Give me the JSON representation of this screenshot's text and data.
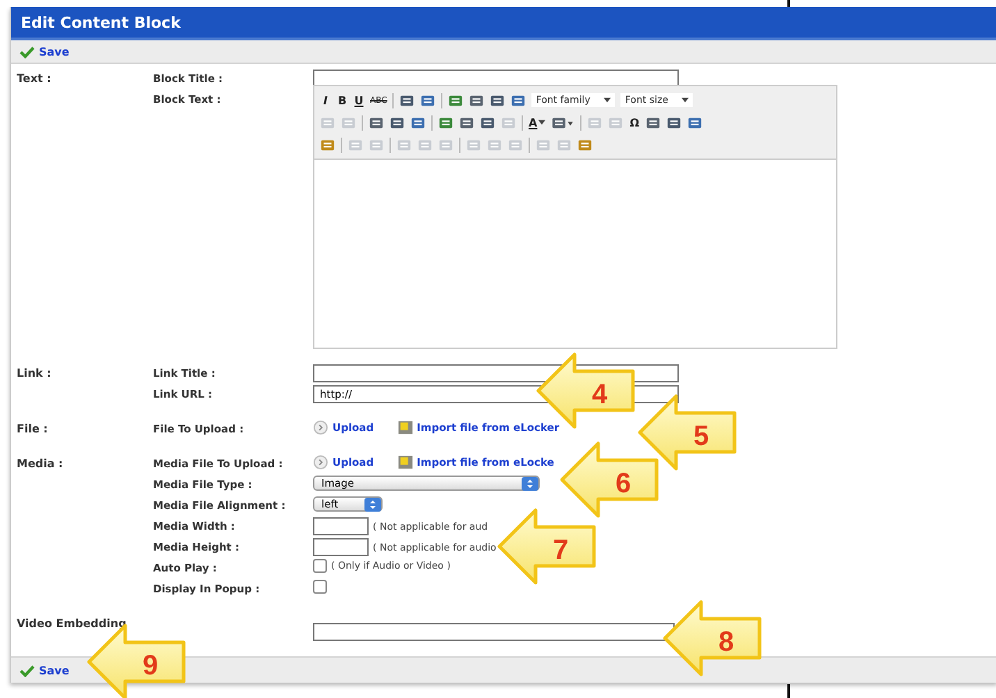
{
  "window": {
    "title": "Edit Content Block"
  },
  "top_toolbar": {
    "save": "Save"
  },
  "sections": [
    {
      "label": "Text :",
      "rows": [
        {
          "kind": "text",
          "label": "Block Title :",
          "value": ""
        },
        {
          "kind": "editor",
          "label": "Block Text :",
          "toolbar": [
            [
              {
                "kind": "italic",
                "text": "I"
              },
              {
                "kind": "bold",
                "text": "B"
              },
              {
                "kind": "underline",
                "text": "U"
              },
              {
                "kind": "strike",
                "text": "ABC"
              },
              {
                "kind": "sep"
              },
              {
                "kind": "icon",
                "disabled": false
              },
              {
                "kind": "icon",
                "disabled": false
              },
              {
                "kind": "sep"
              },
              {
                "kind": "icon",
                "disabled": false
              },
              {
                "kind": "icon",
                "disabled": false
              },
              {
                "kind": "icon",
                "disabled": false
              },
              {
                "kind": "icon",
                "disabled": false
              },
              {
                "kind": "select",
                "text": "Font family"
              },
              {
                "kind": "select",
                "text": "Font size"
              }
            ],
            [
              {
                "kind": "icon",
                "disabled": true
              },
              {
                "kind": "icon",
                "disabled": true
              },
              {
                "kind": "sep"
              },
              {
                "kind": "icon",
                "disabled": false
              },
              {
                "kind": "icon",
                "disabled": false
              },
              {
                "kind": "icon",
                "disabled": false
              },
              {
                "kind": "sep"
              },
              {
                "kind": "icon",
                "disabled": false
              },
              {
                "kind": "icon",
                "disabled": false
              },
              {
                "kind": "icon",
                "disabled": false
              },
              {
                "kind": "icon",
                "disabled": true
              },
              {
                "kind": "sep"
              },
              {
                "kind": "underline",
                "text": "A",
                "caret": true
              },
              {
                "kind": "icon",
                "disabled": false,
                "caret": true
              },
              {
                "kind": "sep"
              },
              {
                "kind": "icon",
                "disabled": true
              },
              {
                "kind": "icon",
                "disabled": true
              },
              {
                "kind": "bold",
                "text": "Ω"
              },
              {
                "kind": "icon",
                "disabled": false
              },
              {
                "kind": "icon",
                "disabled": false
              },
              {
                "kind": "icon",
                "disabled": false
              }
            ],
            [
              {
                "kind": "icon",
                "disabled": false
              },
              {
                "kind": "sep"
              },
              {
                "kind": "icon",
                "disabled": true
              },
              {
                "kind": "icon",
                "disabled": true
              },
              {
                "kind": "sep"
              },
              {
                "kind": "icon",
                "disabled": true
              },
              {
                "kind": "icon",
                "disabled": true
              },
              {
                "kind": "icon",
                "disabled": true
              },
              {
                "kind": "sep"
              },
              {
                "kind": "icon",
                "disabled": true
              },
              {
                "kind": "icon",
                "disabled": true
              },
              {
                "kind": "icon",
                "disabled": true
              },
              {
                "kind": "sep"
              },
              {
                "kind": "icon",
                "disabled": true
              },
              {
                "kind": "icon",
                "disabled": true
              },
              {
                "kind": "icon",
                "disabled": false
              }
            ]
          ]
        }
      ]
    },
    {
      "label": "Link :",
      "rows": [
        {
          "kind": "text",
          "label": "Link Title :",
          "value": ""
        },
        {
          "kind": "text",
          "label": "Link URL :",
          "value": "http://"
        }
      ]
    },
    {
      "label": "File :",
      "rows": [
        {
          "kind": "upload",
          "label": "File To Upload :",
          "upload": "Upload",
          "import": "Import file from eLocker"
        }
      ]
    },
    {
      "label": "Media :",
      "rows": [
        {
          "kind": "upload",
          "label": "Media File To Upload :",
          "upload": "Upload",
          "import": "Import file from eLocke"
        },
        {
          "kind": "select",
          "label": "Media File Type :",
          "value": "Image"
        },
        {
          "kind": "select",
          "label": "Media File Alignment :",
          "value": "left"
        },
        {
          "kind": "text",
          "label": "Media Width :",
          "value": "",
          "note": "( Not applicable for aud"
        },
        {
          "kind": "text",
          "label": "Media Height :",
          "value": "",
          "note": "( Not applicable for audio"
        },
        {
          "kind": "checkbox",
          "label": "Auto Play :",
          "checked": false,
          "note": "( Only if Audio or Video )"
        },
        {
          "kind": "checkbox",
          "label": "Display In Popup :",
          "checked": false
        }
      ]
    },
    {
      "label": "Video Embedding",
      "rows": [
        {
          "kind": "text",
          "label": "",
          "value": ""
        }
      ]
    }
  ],
  "bottom_toolbar": {
    "save": "Save"
  },
  "annotations": [
    {
      "label": "4"
    },
    {
      "label": "5"
    },
    {
      "label": "6"
    },
    {
      "label": "7"
    },
    {
      "label": "8"
    },
    {
      "label": "9"
    }
  ]
}
